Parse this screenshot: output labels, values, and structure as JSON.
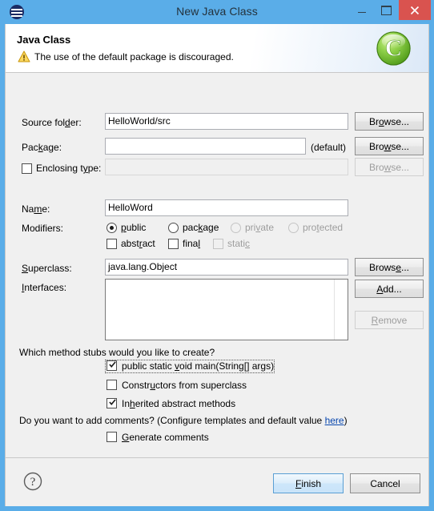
{
  "window": {
    "title": "New Java Class",
    "app_icon": "eclipse-icon",
    "controls": {
      "minimize": "minimize-icon",
      "maximize": "maximize-icon",
      "close": "close-icon"
    }
  },
  "header": {
    "title": "Java Class",
    "message": "The use of the default package is discouraged.",
    "message_icon": "warning-icon",
    "logo_icon": "green-c-logo",
    "logo_letter": "C"
  },
  "form": {
    "source_folder": {
      "label_pre": "Source fol",
      "label_mnemonic": "d",
      "label_post": "er:",
      "value": "HelloWorld/src",
      "browse": {
        "pre": "Br",
        "mnemonic": "o",
        "post": "wse..."
      }
    },
    "package": {
      "label_pre": "Pac",
      "label_mnemonic": "k",
      "label_post": "age:",
      "value": "",
      "suffix": "(default)",
      "browse": {
        "pre": "Bro",
        "mnemonic": "w",
        "post": "se..."
      }
    },
    "enclosing_type": {
      "label_pre": "Enclosing t",
      "label_mnemonic": "y",
      "label_post": "pe:",
      "value": "",
      "checked": false,
      "enabled": false,
      "browse": {
        "pre": "Bro",
        "mnemonic": "w",
        "post": "se..."
      }
    },
    "name": {
      "label_pre": "Na",
      "label_mnemonic": "m",
      "label_post": "e:",
      "value": "HelloWord"
    },
    "modifiers": {
      "label": "Modifiers:",
      "radios": [
        {
          "pre": "",
          "mnemonic": "p",
          "post": "ublic",
          "checked": true,
          "enabled": true
        },
        {
          "pre": "pac",
          "mnemonic": "k",
          "post": "age",
          "checked": false,
          "enabled": true
        },
        {
          "pre": "pri",
          "mnemonic": "v",
          "post": "ate",
          "checked": false,
          "enabled": false
        },
        {
          "pre": "pro",
          "mnemonic": "t",
          "post": "ected",
          "checked": false,
          "enabled": false
        }
      ],
      "checkboxes": [
        {
          "pre": "abst",
          "mnemonic": "r",
          "post": "act",
          "checked": false,
          "enabled": true
        },
        {
          "pre": "fina",
          "mnemonic": "l",
          "post": "",
          "checked": false,
          "enabled": true
        },
        {
          "pre": "stati",
          "mnemonic": "c",
          "post": "",
          "checked": false,
          "enabled": false
        }
      ]
    },
    "superclass": {
      "label_pre": "",
      "label_mnemonic": "S",
      "label_post": "uperclass:",
      "value": "java.lang.Object",
      "browse": {
        "pre": "Brows",
        "mnemonic": "e",
        "post": "..."
      }
    },
    "interfaces": {
      "label_pre": "",
      "label_mnemonic": "I",
      "label_post": "nterfaces:",
      "items": [],
      "add": {
        "pre": "",
        "mnemonic": "A",
        "post": "dd..."
      },
      "remove": {
        "pre": "",
        "mnemonic": "R",
        "post": "emove",
        "enabled": false
      }
    },
    "method_stubs": {
      "question": "Which method stubs would you like to create?",
      "options": [
        {
          "pre": "public static ",
          "mnemonic": "v",
          "post": "oid main(String[] args)",
          "checked": true,
          "focused": true
        },
        {
          "pre": "Constr",
          "mnemonic": "u",
          "post": "ctors from superclass",
          "checked": false,
          "focused": false
        },
        {
          "pre": "In",
          "mnemonic": "h",
          "post": "erited abstract methods",
          "checked": true,
          "focused": false
        }
      ]
    },
    "comments": {
      "question_pre": "Do you want to add comments? (Configure templates and default value ",
      "link": "here",
      "question_post": ")",
      "option": {
        "pre": "",
        "mnemonic": "G",
        "post": "enerate comments",
        "checked": false
      }
    }
  },
  "buttonbar": {
    "help_icon": "help-icon",
    "finish": {
      "pre": "",
      "mnemonic": "F",
      "post": "inish"
    },
    "cancel": {
      "pre": "Cancel",
      "mnemonic": "",
      "post": ""
    }
  },
  "colors": {
    "window_frame": "#5aade8",
    "close_button": "#d9534f",
    "link": "#0645ad",
    "default_button_border": "#5a9fd4",
    "logo_green": "#7ac943",
    "warning_yellow": "#f0c419"
  }
}
